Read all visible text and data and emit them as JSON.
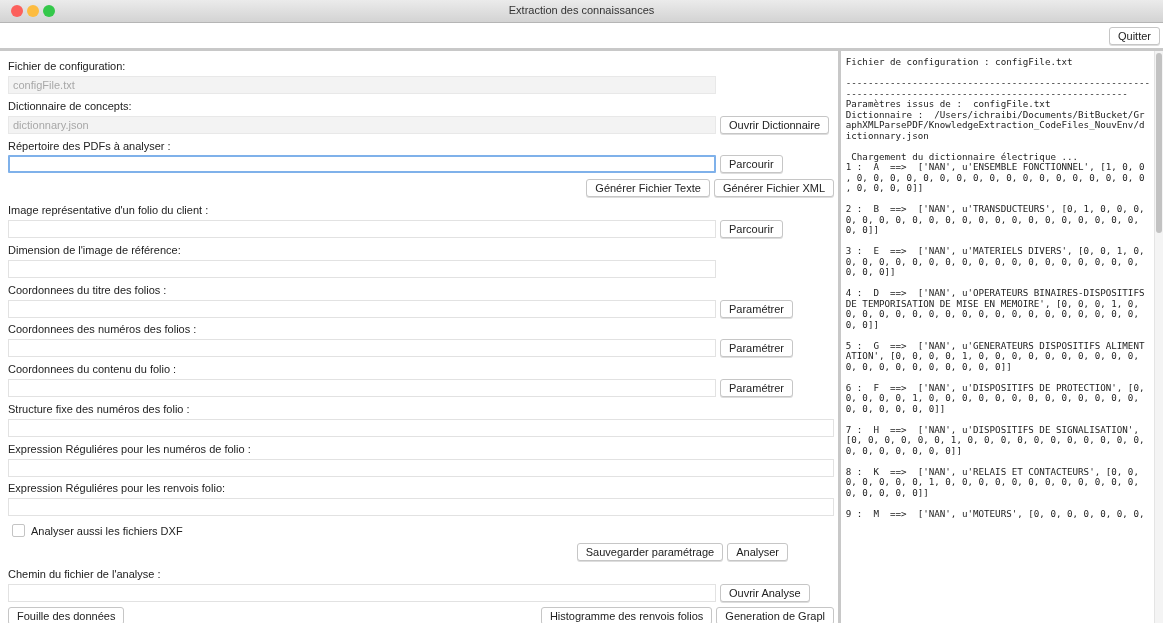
{
  "window": {
    "title": "Extraction des connaissances"
  },
  "toolbar": {
    "buttons": [
      "Quitter"
    ]
  },
  "form": [
    {
      "kind": "field",
      "label": "Fichier de configuration:",
      "value": "configFile.txt",
      "disabled": true,
      "focused": false
    },
    {
      "kind": "field",
      "label": "Dictionnaire de concepts:",
      "value": "dictionnary.json",
      "disabled": true,
      "focused": false,
      "button": "Ouvrir Dictionnaire"
    },
    {
      "kind": "field",
      "label": "Répertoire des PDFs à analyser :",
      "disabled": false,
      "focused": true,
      "button": "Parcourir"
    },
    {
      "kind": "buttons",
      "buttons": [
        "Générer Fichier Texte",
        "Générer Fichier XML"
      ]
    },
    {
      "kind": "field",
      "label": "Image représentative d'un folio du client :",
      "disabled": false,
      "focused": false,
      "button": "Parcourir"
    },
    {
      "kind": "field",
      "label": "Dimension de l'image de référence:",
      "disabled": false,
      "focused": false
    },
    {
      "kind": "field",
      "label": "Coordonnees du titre des folios :",
      "disabled": false,
      "focused": false,
      "button": "Paramétrer"
    },
    {
      "kind": "field",
      "label": "Coordonnees des numéros des folios :",
      "disabled": false,
      "focused": false,
      "button": "Paramétrer"
    },
    {
      "kind": "field",
      "label": "Coordonnees du contenu du folio :",
      "disabled": false,
      "focused": false,
      "button": "Paramétrer"
    },
    {
      "kind": "wide_field",
      "label": "Structure fixe des numéros des folio :",
      "disabled": false,
      "focused": false
    },
    {
      "kind": "wide_field",
      "label": "Expression Réguliéres pour les numéros de folio :",
      "disabled": false,
      "focused": false
    },
    {
      "kind": "wide_field",
      "label": "Expression Réguliéres pour les renvois folio:",
      "disabled": false,
      "focused": false
    },
    {
      "kind": "checkbox",
      "label": "Analyser aussi les fichiers DXF",
      "checked": false
    },
    {
      "kind": "buttons",
      "buttons": [
        "Sauvegarder paramétrage",
        "Analyser"
      ]
    },
    {
      "kind": "field",
      "label": "Chemin du fichier de l'analyse :",
      "disabled": false,
      "focused": false,
      "button": "Ouvrir Analyse"
    }
  ],
  "bottom_bar": {
    "left_buttons": [
      "Fouille des données"
    ],
    "right_buttons": [
      "Histogramme des renvois folios",
      "Generation de Grapl"
    ]
  },
  "log": [
    [
      "Fichier de configuration : configFile.txt"
    ],
    [
      "-------------------------------------------------------",
      "---------------------------------------------------",
      "Paramètres issus de :  configFile.txt",
      "Dictionnaire :  /Users/ichraibi/Documents/BitBucket/Gr",
      "aphXMLParsePDF/KnowledgeExtraction_CodeFiles_NouvEnv/d",
      "ictionnary.json"
    ],
    [
      " Chargement du dictionnaire électrique ...",
      "1 :  A  ==>  ['NAN', u'ENSEMBLE FONCTIONNEL', [1, 0, 0",
      ", 0, 0, 0, 0, 0, 0, 0, 0, 0, 0, 0, 0, 0, 0, 0, 0, 0, 0",
      ", 0, 0, 0, 0]]"
    ],
    [
      "2 :  B  ==>  ['NAN', u'TRANSDUCTEURS', [0, 1, 0, 0, 0,",
      "0, 0, 0, 0, 0, 0, 0, 0, 0, 0, 0, 0, 0, 0, 0, 0, 0, 0,",
      "0, 0]]"
    ],
    [
      "3 :  E  ==>  ['NAN', u'MATERIELS DIVERS', [0, 0, 1, 0,",
      "0, 0, 0, 0, 0, 0, 0, 0, 0, 0, 0, 0, 0, 0, 0, 0, 0, 0,",
      "0, 0, 0]]"
    ],
    [
      "4 :  D  ==>  ['NAN', u'OPERATEURS BINAIRES-DISPOSITIFS",
      "DE TEMPORISATION DE MISE EN MEMOIRE', [0, 0, 0, 1, 0,",
      "0, 0, 0, 0, 0, 0, 0, 0, 0, 0, 0, 0, 0, 0, 0, 0, 0, 0,",
      "0, 0]]"
    ],
    [
      "5 :  G  ==>  ['NAN', u'GENERATEURS DISPOSITIFS ALIMENT",
      "ATION', [0, 0, 0, 0, 1, 0, 0, 0, 0, 0, 0, 0, 0, 0, 0,",
      "0, 0, 0, 0, 0, 0, 0, 0, 0, 0]]"
    ],
    [
      "6 :  F  ==>  ['NAN', u'DISPOSITIFS DE PROTECTION', [0,",
      "0, 0, 0, 0, 1, 0, 0, 0, 0, 0, 0, 0, 0, 0, 0, 0, 0, 0,",
      "0, 0, 0, 0, 0, 0]]"
    ],
    [
      "7 :  H  ==>  ['NAN', u'DISPOSITIFS DE SIGNALISATION',",
      "[0, 0, 0, 0, 0, 0, 1, 0, 0, 0, 0, 0, 0, 0, 0, 0, 0, 0,",
      "0, 0, 0, 0, 0, 0, 0]]"
    ],
    [
      "8 :  K  ==>  ['NAN', u'RELAIS ET CONTACTEURS', [0, 0,",
      "0, 0, 0, 0, 0, 1, 0, 0, 0, 0, 0, 0, 0, 0, 0, 0, 0, 0,",
      "0, 0, 0, 0, 0]]"
    ],
    [
      "9 :  M  ==>  ['NAN', u'MOTEURS', [0, 0, 0, 0, 0, 0, 0,"
    ]
  ]
}
